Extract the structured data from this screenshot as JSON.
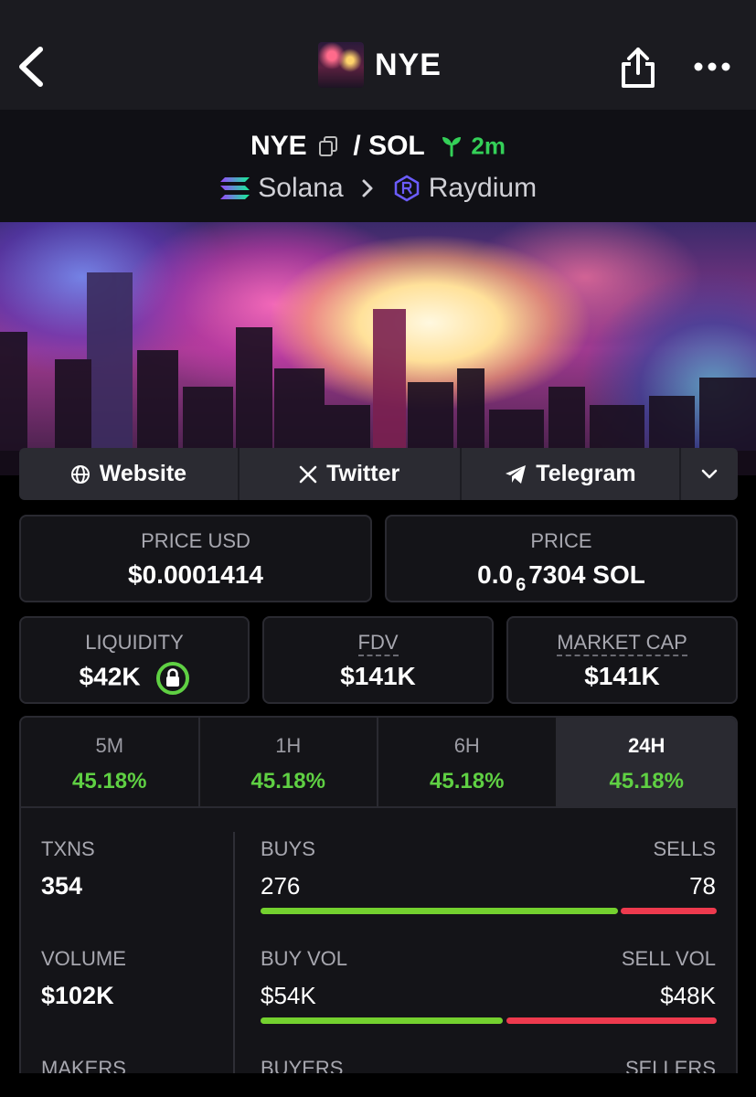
{
  "header": {
    "token_name": "NYE"
  },
  "pair": {
    "base": "NYE",
    "separator": "/",
    "quote": "SOL",
    "age": "2m",
    "chain": "Solana",
    "dex": "Raydium"
  },
  "links": {
    "website": "Website",
    "twitter": "Twitter",
    "telegram": "Telegram"
  },
  "prices": {
    "price_usd_label": "PRICE USD",
    "price_usd": "$0.0001414",
    "price_label": "PRICE",
    "price_sol_prefix": "0.0",
    "price_sol_subscript": "6",
    "price_sol_rest": "7304 SOL"
  },
  "metrics": {
    "liquidity_label": "LIQUIDITY",
    "liquidity": "$42K",
    "fdv_label": "FDV",
    "fdv": "$141K",
    "mcap_label": "MARKET CAP",
    "mcap": "$141K"
  },
  "timeframes": [
    {
      "label": "5M",
      "change": "45.18%"
    },
    {
      "label": "1H",
      "change": "45.18%"
    },
    {
      "label": "6H",
      "change": "45.18%"
    },
    {
      "label": "24H",
      "change": "45.18%"
    }
  ],
  "stats": {
    "txns_label": "TXNS",
    "txns": "354",
    "buys_label": "BUYS",
    "buys": "276",
    "sells_label": "SELLS",
    "sells": "78",
    "volume_label": "VOLUME",
    "volume": "$102K",
    "buy_vol_label": "BUY VOL",
    "buy_vol": "$54K",
    "sell_vol_label": "SELL VOL",
    "sell_vol": "$48K",
    "makers_label": "MAKERS",
    "buyers_label": "BUYERS",
    "sellers_label": "SELLERS"
  },
  "colors": {
    "positive": "#5fd043",
    "buy_bar": "#74d12f",
    "sell_bar": "#ee3a4e",
    "new_pair": "#34d058"
  }
}
